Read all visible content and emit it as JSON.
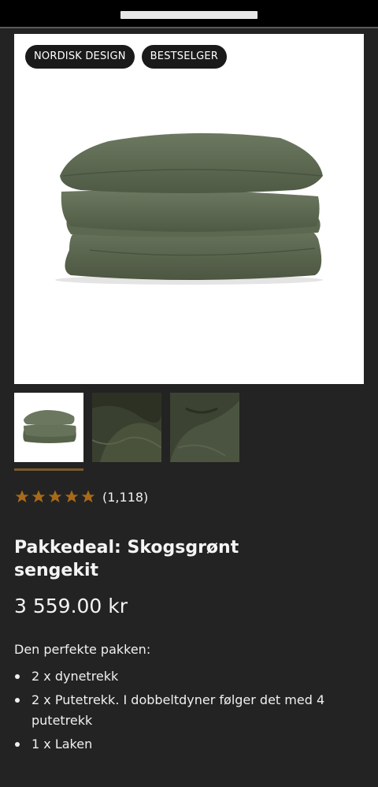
{
  "badges": [
    "NORDISK DESIGN",
    "BESTSELGER"
  ],
  "rating": {
    "stars": 5,
    "count": "(1,118)",
    "star_color": "#a86a1a"
  },
  "product": {
    "title": "Pakkedeal: Skogsgrønt sengekit",
    "price": "3 559.00 kr",
    "intro": "Den perfekte pakken:",
    "items": [
      "2 x dynetrekk",
      "2 x Putetrekk. I dobbeltdyner følger det med 4 putetrekk",
      "1 x Laken"
    ]
  },
  "colors": {
    "background": "#232323",
    "fabric": "#5f6b52",
    "accent": "#7a5a2e"
  }
}
